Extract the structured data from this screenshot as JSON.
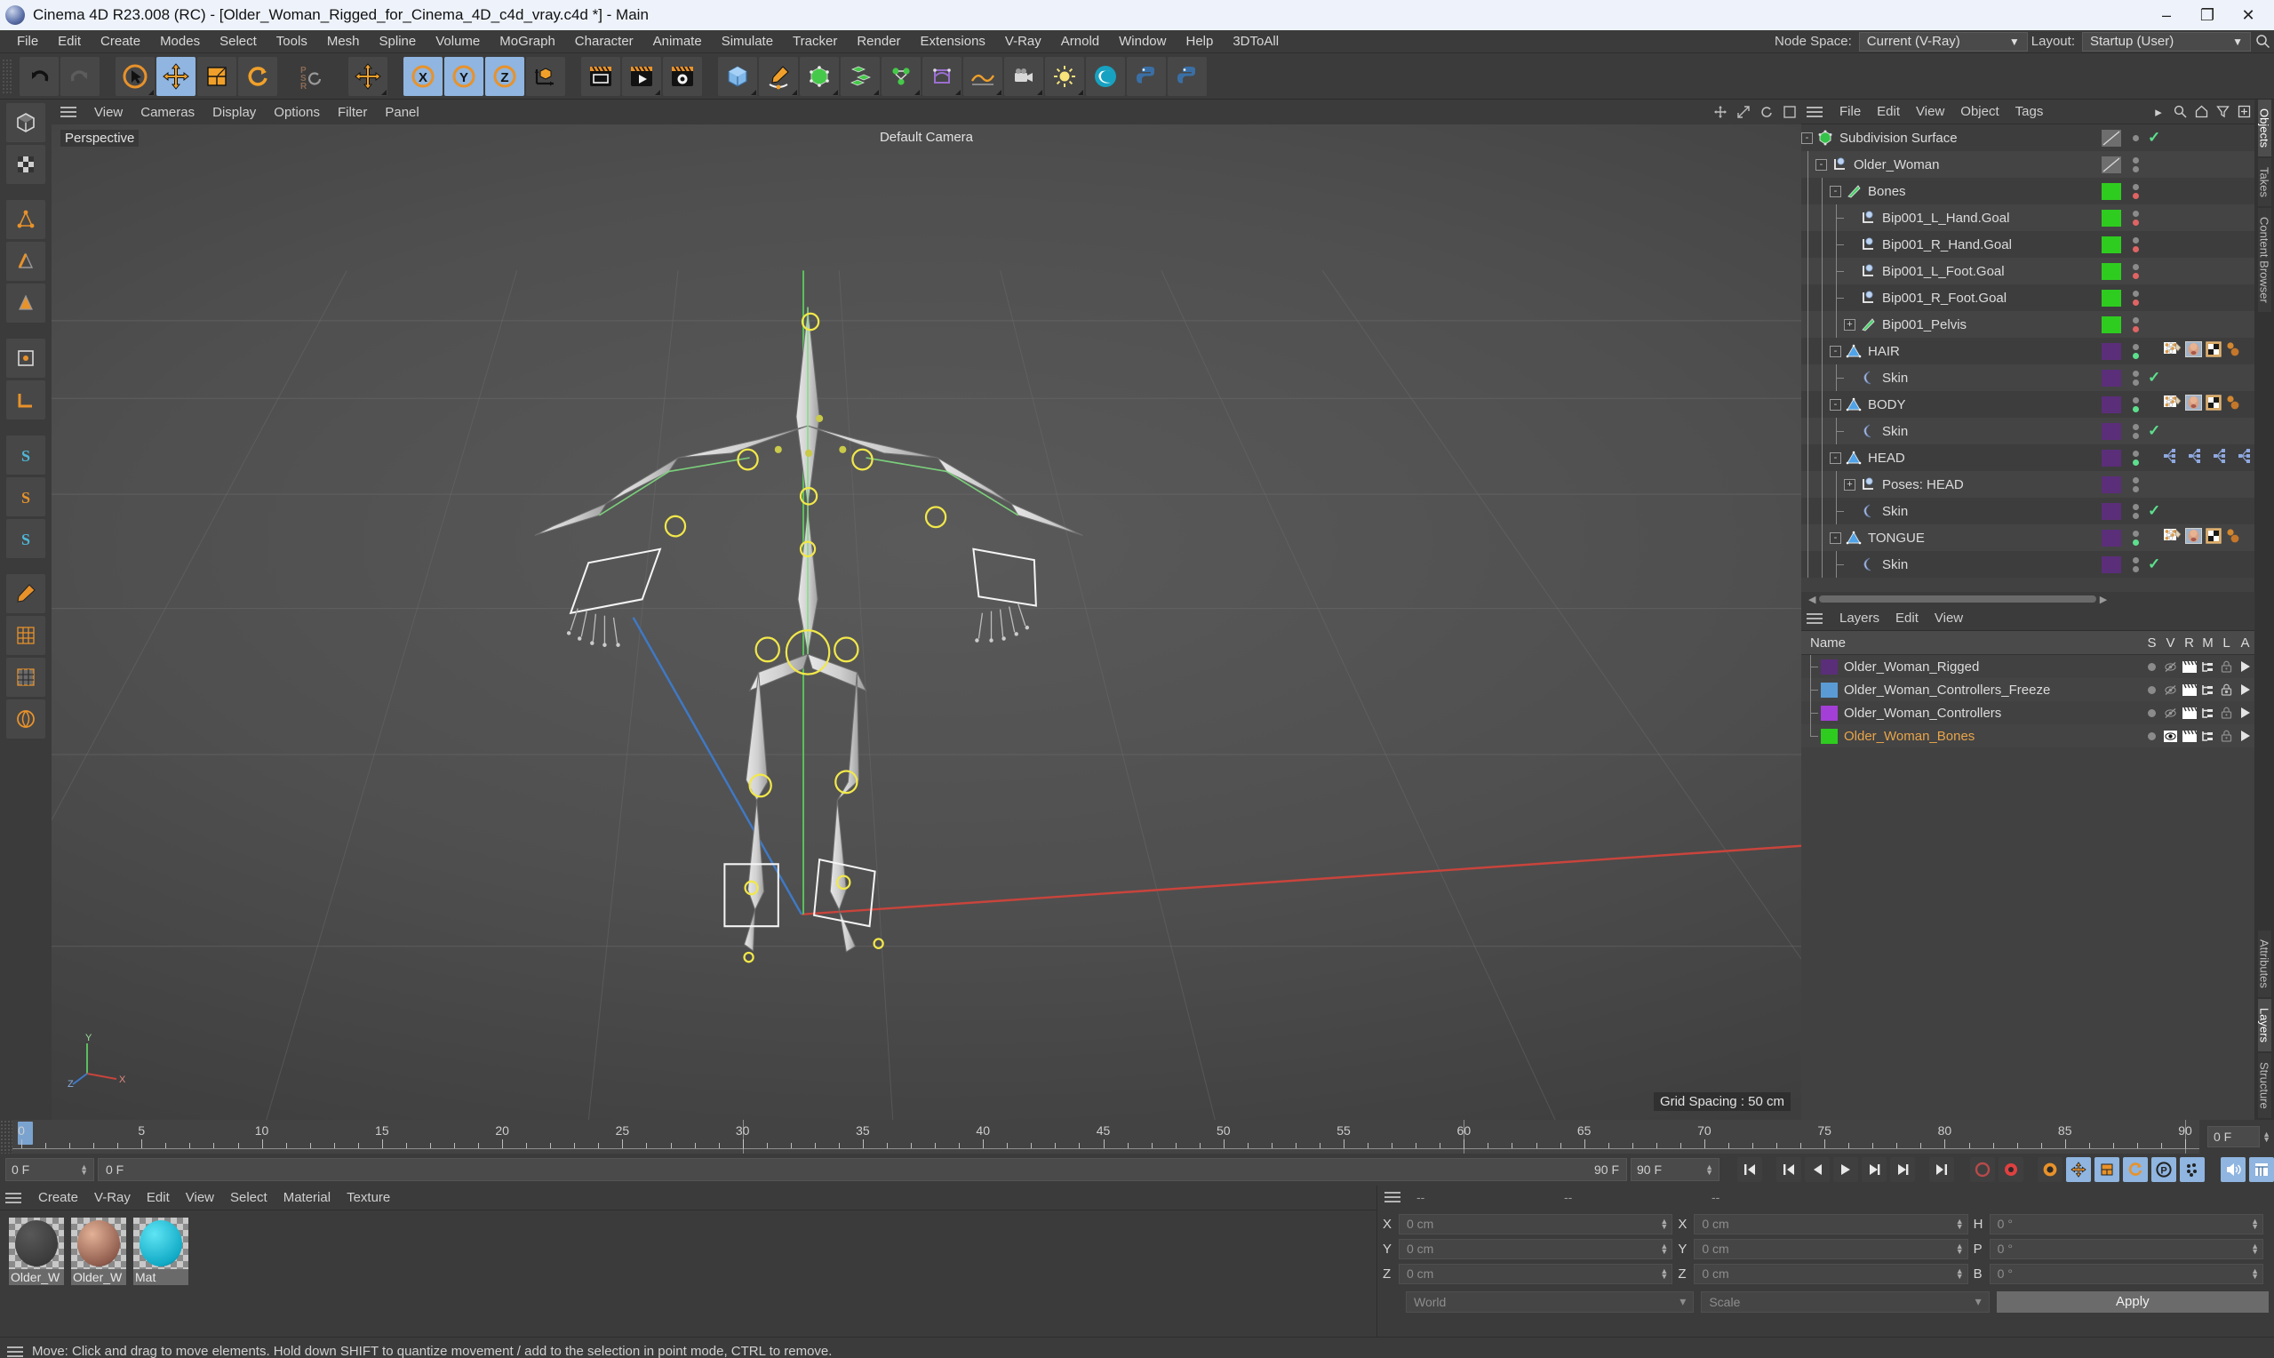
{
  "window": {
    "title": "Cinema 4D R23.008 (RC) - [Older_Woman_Rigged_for_Cinema_4D_c4d_vray.c4d *] - Main",
    "minimize": "–",
    "maximize": "❐",
    "close": "✕"
  },
  "menubar": {
    "items": [
      "File",
      "Edit",
      "Create",
      "Modes",
      "Select",
      "Tools",
      "Mesh",
      "Spline",
      "Volume",
      "MoGraph",
      "Character",
      "Animate",
      "Simulate",
      "Tracker",
      "Render",
      "Extensions",
      "V-Ray",
      "Arnold",
      "Window",
      "Help",
      "3DToAll"
    ],
    "node_space_label": "Node Space:",
    "node_space_value": "Current (V-Ray)",
    "layout_label": "Layout:",
    "layout_value": "Startup (User)",
    "search_icon": "search-icon"
  },
  "toolbar": {
    "undo": "undo-icon",
    "redo": "redo-icon",
    "live_selection": "live-selection-icon",
    "move": "move-icon",
    "scale": "scale-icon",
    "rotate": "rotate-icon",
    "psr": "psr-icon",
    "world_move": "world-axis-move-icon",
    "axis_x": "X",
    "axis_y": "Y",
    "axis_z": "Z",
    "coord_system": "coordinate-system-icon",
    "render_view": "render-view-icon",
    "render_picture": "render-picture-icon",
    "render_settings": "render-settings-icon",
    "cube": "primitive-cube-icon",
    "spline_pen": "spline-pen-icon",
    "subdivision": "subdivision-surface-icon",
    "array": "array-icon",
    "scene_nodes": "scene-nodes-icon",
    "deformer": "deformer-icon",
    "environment": "environment-icon",
    "camera": "camera-icon",
    "light": "light-icon",
    "vray": "vray-icon",
    "python": "python-icon",
    "python2": "python-field-icon"
  },
  "lefttools": {
    "items": [
      "model-mode-icon",
      "texture-mode-icon",
      "points-mode-icon",
      "edges-mode-icon",
      "polygons-mode-icon",
      "enable-axis-icon",
      "workplane-icon",
      "snap-icon",
      "snap-s2-icon",
      "snap-s3-icon",
      "spline-pen-left-icon",
      "uv-mesh-icon",
      "uv-polygon-icon",
      "deformer-left-icon"
    ]
  },
  "viewport": {
    "menu": [
      "View",
      "Cameras",
      "Display",
      "Options",
      "Filter",
      "Panel"
    ],
    "label_perspective": "Perspective",
    "label_camera": "Default Camera",
    "label_grid": "Grid Spacing : 50 cm",
    "axis_x": "X",
    "axis_y": "Y",
    "axis_z": "Z"
  },
  "objectmanager": {
    "menu": [
      "File",
      "Edit",
      "View",
      "Object",
      "Tags"
    ],
    "icons": [
      "search-icon",
      "home-icon",
      "filter-icon",
      "add-icon"
    ],
    "rows": [
      {
        "label": "Subdivision Surface",
        "depth": 0,
        "icon": "subdivision-surface-icon",
        "expander": "-",
        "swatch": "hatch",
        "dots": [
          "grey"
        ],
        "check": true,
        "tags": []
      },
      {
        "label": "Older_Woman",
        "depth": 1,
        "icon": "null-object-icon",
        "expander": "-",
        "swatch": "hatch",
        "dots": [
          "grey",
          "grey"
        ],
        "check": false,
        "tags": []
      },
      {
        "label": "Bones",
        "depth": 2,
        "icon": "joint-icon",
        "expander": "-",
        "swatch": "#2ecc1f",
        "dots": [
          "grey",
          "red"
        ],
        "check": false,
        "tags": []
      },
      {
        "label": "Bip001_L_Hand.Goal",
        "depth": 3,
        "icon": "null-object-icon",
        "expander": "",
        "swatch": "#2ecc1f",
        "dots": [
          "grey",
          "red"
        ],
        "check": false,
        "tags": []
      },
      {
        "label": "Bip001_R_Hand.Goal",
        "depth": 3,
        "icon": "null-object-icon",
        "expander": "",
        "swatch": "#2ecc1f",
        "dots": [
          "grey",
          "red"
        ],
        "check": false,
        "tags": []
      },
      {
        "label": "Bip001_L_Foot.Goal",
        "depth": 3,
        "icon": "null-object-icon",
        "expander": "",
        "swatch": "#2ecc1f",
        "dots": [
          "grey",
          "red"
        ],
        "check": false,
        "tags": []
      },
      {
        "label": "Bip001_R_Foot.Goal",
        "depth": 3,
        "icon": "null-object-icon",
        "expander": "",
        "swatch": "#2ecc1f",
        "dots": [
          "grey",
          "red"
        ],
        "check": false,
        "tags": []
      },
      {
        "label": "Bip001_Pelvis",
        "depth": 3,
        "icon": "joint-icon",
        "expander": "+",
        "swatch": "#2ecc1f",
        "dots": [
          "grey",
          "red"
        ],
        "check": false,
        "tags": []
      },
      {
        "label": "HAIR",
        "depth": 2,
        "icon": "polygon-object-icon",
        "expander": "-",
        "swatch": "#5b2e7a",
        "dots": [
          "grey",
          "green"
        ],
        "check": false,
        "tags": [
          "phong-tag",
          "texture-tag",
          "uv-tag",
          "selection-tag"
        ]
      },
      {
        "label": "Skin",
        "depth": 3,
        "icon": "skin-deformer-icon",
        "expander": "",
        "swatch": "#5b2e7a",
        "dots": [
          "grey",
          "grey"
        ],
        "check": true,
        "tags": []
      },
      {
        "label": "BODY",
        "depth": 2,
        "icon": "polygon-object-icon",
        "expander": "-",
        "swatch": "#5b2e7a",
        "dots": [
          "grey",
          "green"
        ],
        "check": false,
        "tags": [
          "phong-tag",
          "texture-tag",
          "uv-tag",
          "selection-tag"
        ]
      },
      {
        "label": "Skin",
        "depth": 3,
        "icon": "skin-deformer-icon",
        "expander": "",
        "swatch": "#5b2e7a",
        "dots": [
          "grey",
          "grey"
        ],
        "check": true,
        "tags": []
      },
      {
        "label": "HEAD",
        "depth": 2,
        "icon": "polygon-object-icon",
        "expander": "-",
        "swatch": "#5b2e7a",
        "dots": [
          "grey",
          "green"
        ],
        "check": false,
        "tags": [
          "pose-morph-tag",
          "pose-morph-tag",
          "pose-morph-tag",
          "pose-morph-tag",
          "pose-morph-tag",
          "pose-morph-tag",
          "pose-morph-tag",
          "pose-morph-tag",
          "pose-morph-tag"
        ]
      },
      {
        "label": "Poses: HEAD",
        "depth": 3,
        "icon": "null-object-icon",
        "expander": "+",
        "swatch": "#5b2e7a",
        "dots": [
          "grey",
          "grey"
        ],
        "check": false,
        "tags": []
      },
      {
        "label": "Skin",
        "depth": 3,
        "icon": "skin-deformer-icon",
        "expander": "",
        "swatch": "#5b2e7a",
        "dots": [
          "grey",
          "grey"
        ],
        "check": true,
        "tags": []
      },
      {
        "label": "TONGUE",
        "depth": 2,
        "icon": "polygon-object-icon",
        "expander": "-",
        "swatch": "#5b2e7a",
        "dots": [
          "grey",
          "green"
        ],
        "check": false,
        "tags": [
          "phong-tag",
          "texture-tag",
          "uv-tag",
          "selection-tag"
        ]
      },
      {
        "label": "Skin",
        "depth": 3,
        "icon": "skin-deformer-icon",
        "expander": "",
        "swatch": "#5b2e7a",
        "dots": [
          "grey",
          "grey"
        ],
        "check": true,
        "tags": []
      }
    ]
  },
  "layermanager": {
    "menu": [
      "Layers",
      "Edit",
      "View"
    ],
    "columns": [
      "Name",
      "S",
      "V",
      "R",
      "M",
      "L",
      "A"
    ],
    "rows": [
      {
        "name": "Older_Woman_Rigged",
        "color": "#5b2e7a",
        "selected": false,
        "visible": false,
        "locked": false
      },
      {
        "name": "Older_Woman_Controllers_Freeze",
        "color": "#5a9bd5",
        "selected": false,
        "visible": false,
        "locked": true
      },
      {
        "name": "Older_Woman_Controllers",
        "color": "#a33fd6",
        "selected": false,
        "visible": false,
        "locked": false
      },
      {
        "name": "Older_Woman_Bones",
        "color": "#2ecc1f",
        "selected": true,
        "visible": true,
        "locked": false
      }
    ]
  },
  "vtabs_right": [
    "Objects",
    "Takes",
    "Content Browser"
  ],
  "vtabs_lower": [
    "Attributes",
    "Layers",
    "Structure"
  ],
  "timeline": {
    "ticks": [
      0,
      5,
      10,
      15,
      20,
      25,
      30,
      35,
      40,
      45,
      50,
      55,
      60,
      65,
      70,
      75,
      80,
      85,
      90
    ],
    "start": 0,
    "end": 90,
    "current_frame": "0 F",
    "frame_field_left": "0 F",
    "frame_track_left": "0 F",
    "frame_track_right": "90 F",
    "frame_end_field": "90 F"
  },
  "playbar": {
    "buttons": [
      "go-to-start-icon",
      "go-to-previous-key-icon",
      "step-back-icon",
      "play-icon",
      "step-forward-icon",
      "go-to-next-key-icon",
      "go-to-end-icon",
      "record-active-objects-icon",
      "autokeying-icon",
      "keyframe-selection-icon",
      "position-key-icon",
      "scale-key-icon",
      "rotation-key-icon",
      "param-key-icon",
      "pla-key-icon",
      "sound-icon",
      "timeline-icon"
    ]
  },
  "materialmanager": {
    "menu": [
      "Create",
      "V-Ray",
      "Edit",
      "View",
      "Select",
      "Material",
      "Texture"
    ],
    "materials": [
      {
        "name": "Older_W",
        "color1": "#585858",
        "color2": "#3a3a3a"
      },
      {
        "name": "Older_W",
        "color1": "#e2b196",
        "color2": "#8d5a4b"
      },
      {
        "name": "Mat",
        "color1": "#5fe4f4",
        "color2": "#0ea8c4"
      }
    ]
  },
  "coordinates": {
    "header": [
      "--",
      "--",
      "--"
    ],
    "pos_label": [
      "X",
      "Y",
      "Z"
    ],
    "pos_values": [
      "0 cm",
      "0 cm",
      "0 cm"
    ],
    "size_label": [
      "X",
      "Y",
      "Z"
    ],
    "size_values": [
      "0 cm",
      "0 cm",
      "0 cm"
    ],
    "rot_label": [
      "H",
      "P",
      "B"
    ],
    "rot_values": [
      "0 °",
      "0 °",
      "0 °"
    ],
    "system": "World",
    "mode": "Scale",
    "apply": "Apply"
  },
  "status": {
    "message": "Move: Click and drag to move elements. Hold down SHIFT to quantize movement / add to the selection in point mode, CTRL to remove."
  }
}
